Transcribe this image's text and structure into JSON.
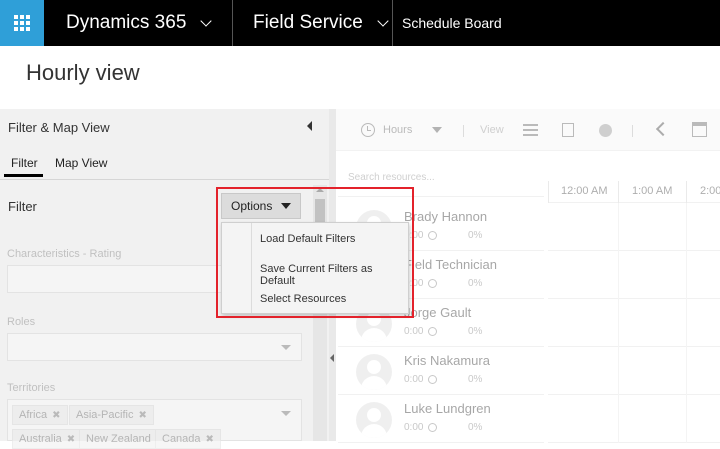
{
  "topbar": {
    "app_name": "Dynamics 365",
    "area_name": "Field Service",
    "page_name": "Schedule Board"
  },
  "page": {
    "title": "Hourly view"
  },
  "left_panel": {
    "header": "Filter & Map View",
    "tabs": [
      {
        "label": "Filter",
        "selected": true
      },
      {
        "label": "Map View",
        "selected": false
      }
    ],
    "filter_label": "Filter",
    "options_label": "Options",
    "fields": [
      {
        "label": "Characteristics - Rating"
      },
      {
        "label": "Roles"
      },
      {
        "label": "Territories"
      }
    ],
    "territory_chips": [
      "Africa",
      "Asia-Pacific",
      "Australia",
      "New Zealand",
      "Canada"
    ]
  },
  "options_menu": {
    "items": [
      "Load Default Filters",
      "Save Current Filters as Default",
      "Select Resources"
    ]
  },
  "toolbar": {
    "view_mode": "Hours",
    "view_label": "View"
  },
  "board": {
    "search_placeholder": "Search resources...",
    "time_labels": [
      "12:00 AM",
      "1:00 AM",
      "2:00"
    ],
    "resources": [
      {
        "name": "Brady Hannon",
        "hours": "0:00",
        "utilization": "0%"
      },
      {
        "name": "Field Technician",
        "hours": "0:00",
        "utilization": "0%"
      },
      {
        "name": "Jorge Gault",
        "hours": "0:00",
        "utilization": "0%"
      },
      {
        "name": "Kris Nakamura",
        "hours": "0:00",
        "utilization": "0%"
      },
      {
        "name": "Luke Lundgren",
        "hours": "0:00",
        "utilization": "0%"
      }
    ]
  },
  "colors": {
    "waffle_blue": "#2f9fd8",
    "highlight_red": "#e3222b",
    "topbar_black": "#000000"
  }
}
